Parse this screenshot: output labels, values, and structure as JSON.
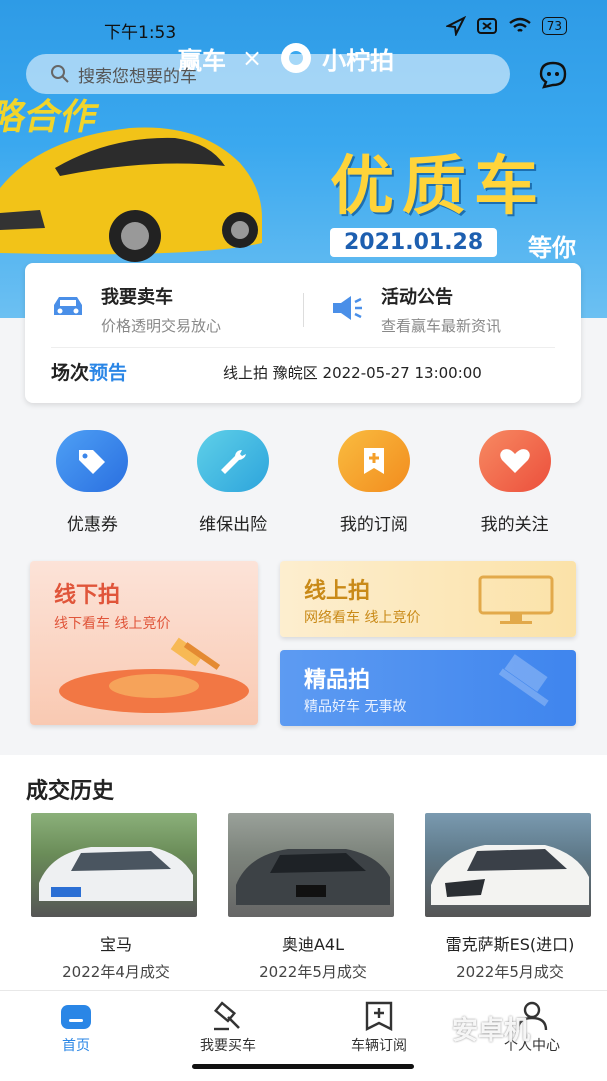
{
  "status": {
    "time": "下午1:53",
    "battery": "73"
  },
  "header": {
    "brand_left": "赢车",
    "brand_x": "×",
    "brand_right": "小柠拍"
  },
  "search": {
    "placeholder": "搜索您想要的车"
  },
  "banner": {
    "tag": "略合作",
    "headline": "优质车",
    "date": "2021.01.28",
    "wait": "等你"
  },
  "card": {
    "sell": {
      "title": "我要卖车",
      "subtitle": "价格透明交易放心"
    },
    "notice": {
      "title": "活动公告",
      "subtitle": "查看赢车最新资讯"
    },
    "schedule_label_a": "场次",
    "schedule_label_b": "预告",
    "schedule_text": "线上拍 豫皖区 2022-05-27 13:00:00"
  },
  "quick": [
    {
      "label": "优惠券",
      "icon": "tag-icon",
      "color": "#2f7fe6"
    },
    {
      "label": "维保出险",
      "icon": "wrench-icon",
      "color": "#3ab7e0"
    },
    {
      "label": "我的订阅",
      "icon": "bookmark-plus-icon",
      "color": "#f4a42a"
    },
    {
      "label": "我的关注",
      "icon": "heart-icon",
      "color": "#f06a4a"
    }
  ],
  "auctions": {
    "offline": {
      "title": "线下拍",
      "subtitle": "线下看车 线上竞价"
    },
    "online": {
      "title": "线上拍",
      "subtitle": "网络看车 线上竞价"
    },
    "premium": {
      "title": "精品拍",
      "subtitle": "精品好车 无事故"
    }
  },
  "history": {
    "title": "成交历史",
    "cars": [
      {
        "name": "宝马",
        "date": "2022年4月成交"
      },
      {
        "name": "奥迪A4L",
        "date": "2022年5月成交"
      },
      {
        "name": "雷克萨斯ES(进口)",
        "date": "2022年5月成交"
      }
    ]
  },
  "tabs": [
    {
      "label": "首页",
      "icon": "home-icon",
      "active": true
    },
    {
      "label": "我要买车",
      "icon": "gavel-icon",
      "active": false
    },
    {
      "label": "车辆订阅",
      "icon": "subscribe-icon",
      "active": false
    },
    {
      "label": "个人中心",
      "icon": "user-icon",
      "active": false
    }
  ],
  "watermark": "安卓机"
}
